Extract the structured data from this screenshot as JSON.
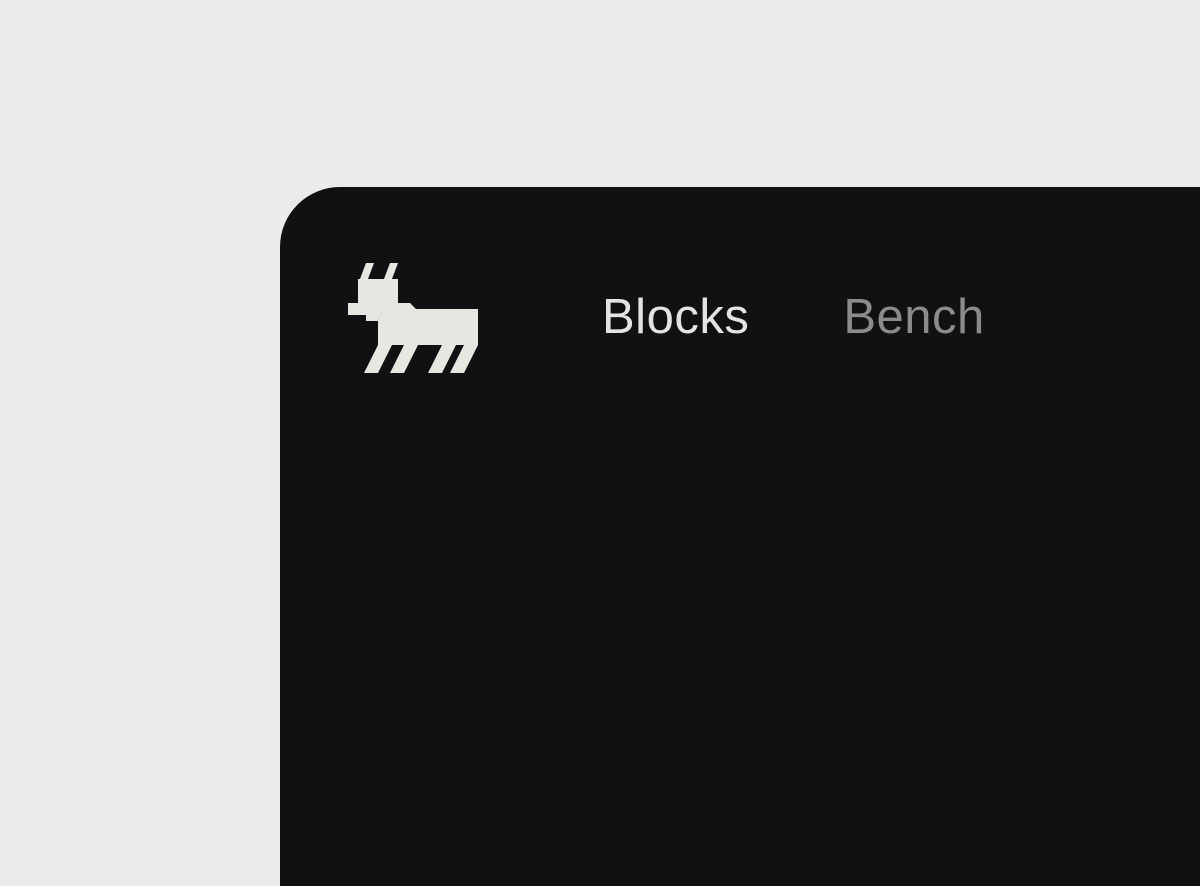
{
  "colors": {
    "page_background": "#ebebed",
    "window_background": "#111113",
    "logo": "#e8e6e1",
    "nav_active": "#e4e4e6",
    "nav_inactive": "#8b8b8e"
  },
  "header": {
    "logo_icon": "goat-icon",
    "nav": [
      {
        "label": "Blocks",
        "active": true
      },
      {
        "label": "Bench",
        "active": false
      }
    ]
  }
}
